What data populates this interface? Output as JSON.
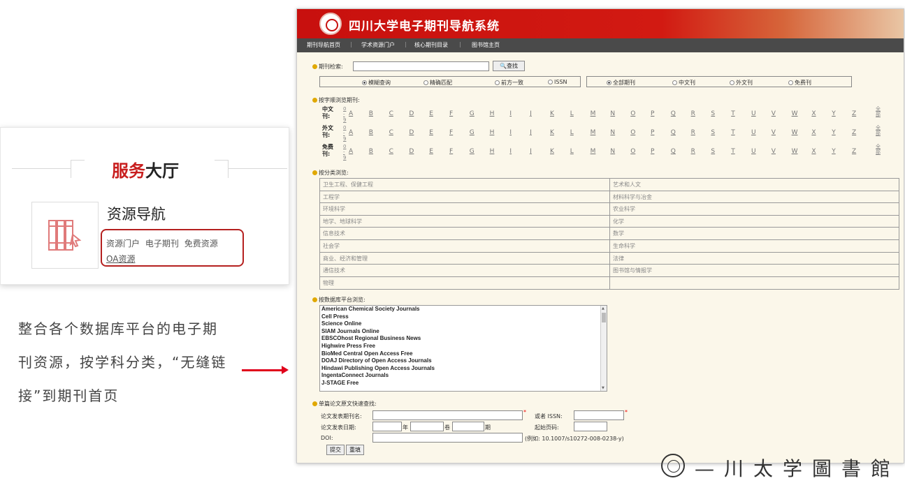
{
  "card": {
    "title_red": "服务",
    "title_dark": "大厅",
    "heading": "资源导航",
    "links": [
      "资源门户",
      "电子期刊",
      "免费资源"
    ],
    "oa_link": "OA资源",
    "icon": "bookshelf-icon"
  },
  "description": "整合各个数据库平台的电子期刊资源，按学科分类，“无缝链接”到期刊首页",
  "system": {
    "title": "四川大学电子期刊导航系统",
    "nav": [
      "期刊导航首页",
      "学术资源门户",
      "核心期刊目录",
      "图书馆主页"
    ],
    "search": {
      "label": "期刊检索:",
      "input_value": "",
      "button": "查找",
      "match_options": [
        "模糊查询",
        "精确匹配",
        "前方一致",
        "ISSN"
      ],
      "match_selected": "模糊查询",
      "type_options": [
        "全部期刊",
        "中文刊",
        "外文刊",
        "免费刊"
      ],
      "type_selected": "全部期刊"
    },
    "browse_alpha": {
      "label": "按字顺浏览期刊:",
      "rows": [
        {
          "label": "中文刊:"
        },
        {
          "label": "外文刊:"
        },
        {
          "label": "免费刊:"
        }
      ],
      "digits": "0-9",
      "letters": [
        "A",
        "B",
        "C",
        "D",
        "E",
        "F",
        "G",
        "H",
        "I",
        "J",
        "K",
        "L",
        "M",
        "N",
        "O",
        "P",
        "Q",
        "R",
        "S",
        "T",
        "U",
        "V",
        "W",
        "X",
        "Y",
        "Z"
      ],
      "all": "全部"
    },
    "browse_category": {
      "label": "按分类浏览:",
      "left": [
        "卫生工程、保健工程",
        "工程学",
        "环境科学",
        "地学、地球科学",
        "信息技术",
        "社会学",
        "商业、经济和管理",
        "通信技术",
        "物理"
      ],
      "right": [
        "艺术和人文",
        "材料科学与冶金",
        "农业科学",
        "化学",
        "数学",
        "生命科学",
        "法律",
        "图书馆与情报学",
        ""
      ]
    },
    "browse_db": {
      "label": "按数据库平台浏览:",
      "items": [
        "American Chemical Society Journals",
        "Cell Press",
        "Science Online",
        "SIAM Journals Online",
        "EBSCOhost Regional Business News",
        "Highwire Press Free",
        "BioMed Central Open Access Free",
        "DOAJ Directory of Open Access Journals",
        "Hindawi Publishing Open Access Journals",
        "IngentaConnect Journals",
        "J-STAGE Free"
      ]
    },
    "article_search": {
      "label": "单篇论文原文快速查找:",
      "journal_label": "论文发表期刊名:",
      "issn_label": "或者 ISSN:",
      "date_label": "论文发表日期:",
      "year_unit": "年",
      "volume_unit": "卷",
      "issue_unit": "期",
      "start_page_label": "起始页码:",
      "doi_label": "DOI:",
      "doi_example": "(例如: 10.1007/s10272-008-0238-y)",
      "submit": "提交",
      "reset": "重填"
    }
  },
  "colors": {
    "accent_red": "#c81e1e",
    "banner_red": "#c8100e",
    "arrow_red": "#e0001b",
    "nav_bg": "#4a4a4a",
    "page_bg": "#fbf7ea"
  }
}
